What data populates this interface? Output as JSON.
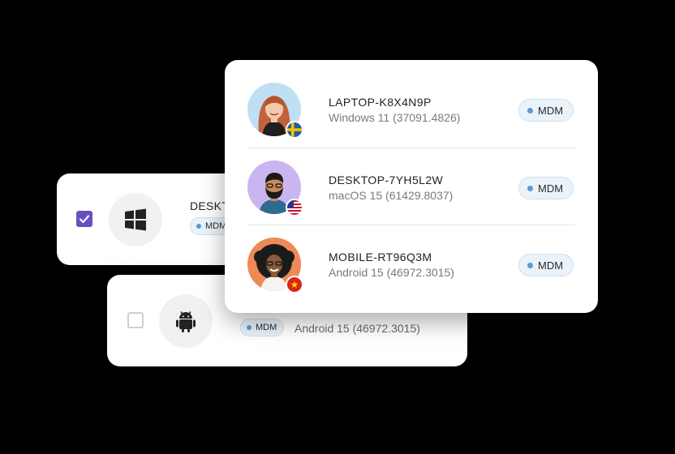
{
  "back_cards": {
    "windows": {
      "title_partial": "DESKT",
      "mdm_label": "MDM",
      "checked": true,
      "icon": "windows-icon"
    },
    "android": {
      "mdm_label": "MDM",
      "os_text": "Android 15 (46972.3015)",
      "checked": false,
      "icon": "android-icon"
    }
  },
  "devices": [
    {
      "name": "LAPTOP-K8X4N9P",
      "os": "Windows 11 (37091.4826)",
      "badge": "MDM",
      "flag": "sweden-flag-icon"
    },
    {
      "name": "DESKTOP-7YH5L2W",
      "os": "macOS 15 (61429.8037)",
      "badge": "MDM",
      "flag": "usa-flag-icon"
    },
    {
      "name": "MOBILE-RT96Q3M",
      "os": "Android 15 (46972.3015)",
      "badge": "MDM",
      "flag": "vietnam-flag-icon"
    }
  ],
  "colors": {
    "checkbox_accent": "#6a4ec0",
    "mdm_dot": "#5b9bd1",
    "mdm_bg": "#eaf2fa"
  }
}
